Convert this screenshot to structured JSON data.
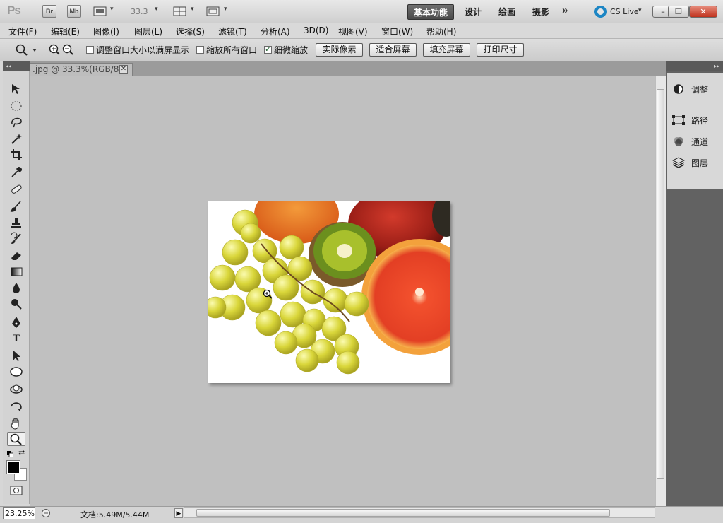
{
  "app": {
    "logo_text": "Ps",
    "bridge_label": "Br",
    "minibridge_label": "Mb",
    "zoom_value": "33.3",
    "dropdown_glyph": "▾",
    "workspaces": [
      "基本功能",
      "设计",
      "绘画",
      "摄影"
    ],
    "active_workspace": "基本功能",
    "more_glyph": "»",
    "cs_live_label": "CS Live",
    "window_buttons": [
      "–",
      "❐",
      "✕"
    ]
  },
  "menubar": {
    "items": [
      "文件(F)",
      "编辑(E)",
      "图像(I)",
      "图层(L)",
      "选择(S)",
      "滤镜(T)",
      "分析(A)",
      "3D(D)",
      "视图(V)",
      "窗口(W)",
      "帮助(H)"
    ]
  },
  "options": {
    "checkboxes": [
      {
        "label": "调整窗口大小以满屏显示",
        "checked": false
      },
      {
        "label": "缩放所有窗口",
        "checked": false
      },
      {
        "label": "细微缩放",
        "checked": true
      }
    ],
    "buttons": [
      "实际像素",
      "适合屏幕",
      "填充屏幕",
      "打印尺寸"
    ]
  },
  "document": {
    "tab_label": ".jpg @ 33.3%(RGB/8)",
    "close_glyph": "✕"
  },
  "tools": [
    "move-tool",
    "marquee-tool",
    "lasso-tool",
    "magic-wand-tool",
    "crop-tool",
    "eyedropper-tool",
    "healing-brush-tool",
    "brush-tool",
    "clone-stamp-tool",
    "history-brush-tool",
    "eraser-tool",
    "gradient-tool",
    "blur-tool",
    "dodge-tool",
    "pen-tool",
    "type-tool",
    "path-selection-tool",
    "shape-tool",
    "3d-rotate-tool",
    "3d-orbit-tool",
    "hand-tool",
    "zoom-tool"
  ],
  "tool_glyphs": {
    "type-tool": "T"
  },
  "colors": {
    "foreground": "#000000",
    "background": "#ffffff",
    "cs_live_accent": "#1d86c4"
  },
  "right_panel": {
    "items": [
      {
        "icon": "adjustments-icon",
        "label": "调整"
      },
      {
        "icon": "paths-icon",
        "label": "路径"
      },
      {
        "icon": "channels-icon",
        "label": "通道"
      },
      {
        "icon": "layers-icon",
        "label": "图层"
      }
    ]
  },
  "status": {
    "zoom": "23.25%",
    "doc_info": "文档:5.49M/5.44M"
  }
}
